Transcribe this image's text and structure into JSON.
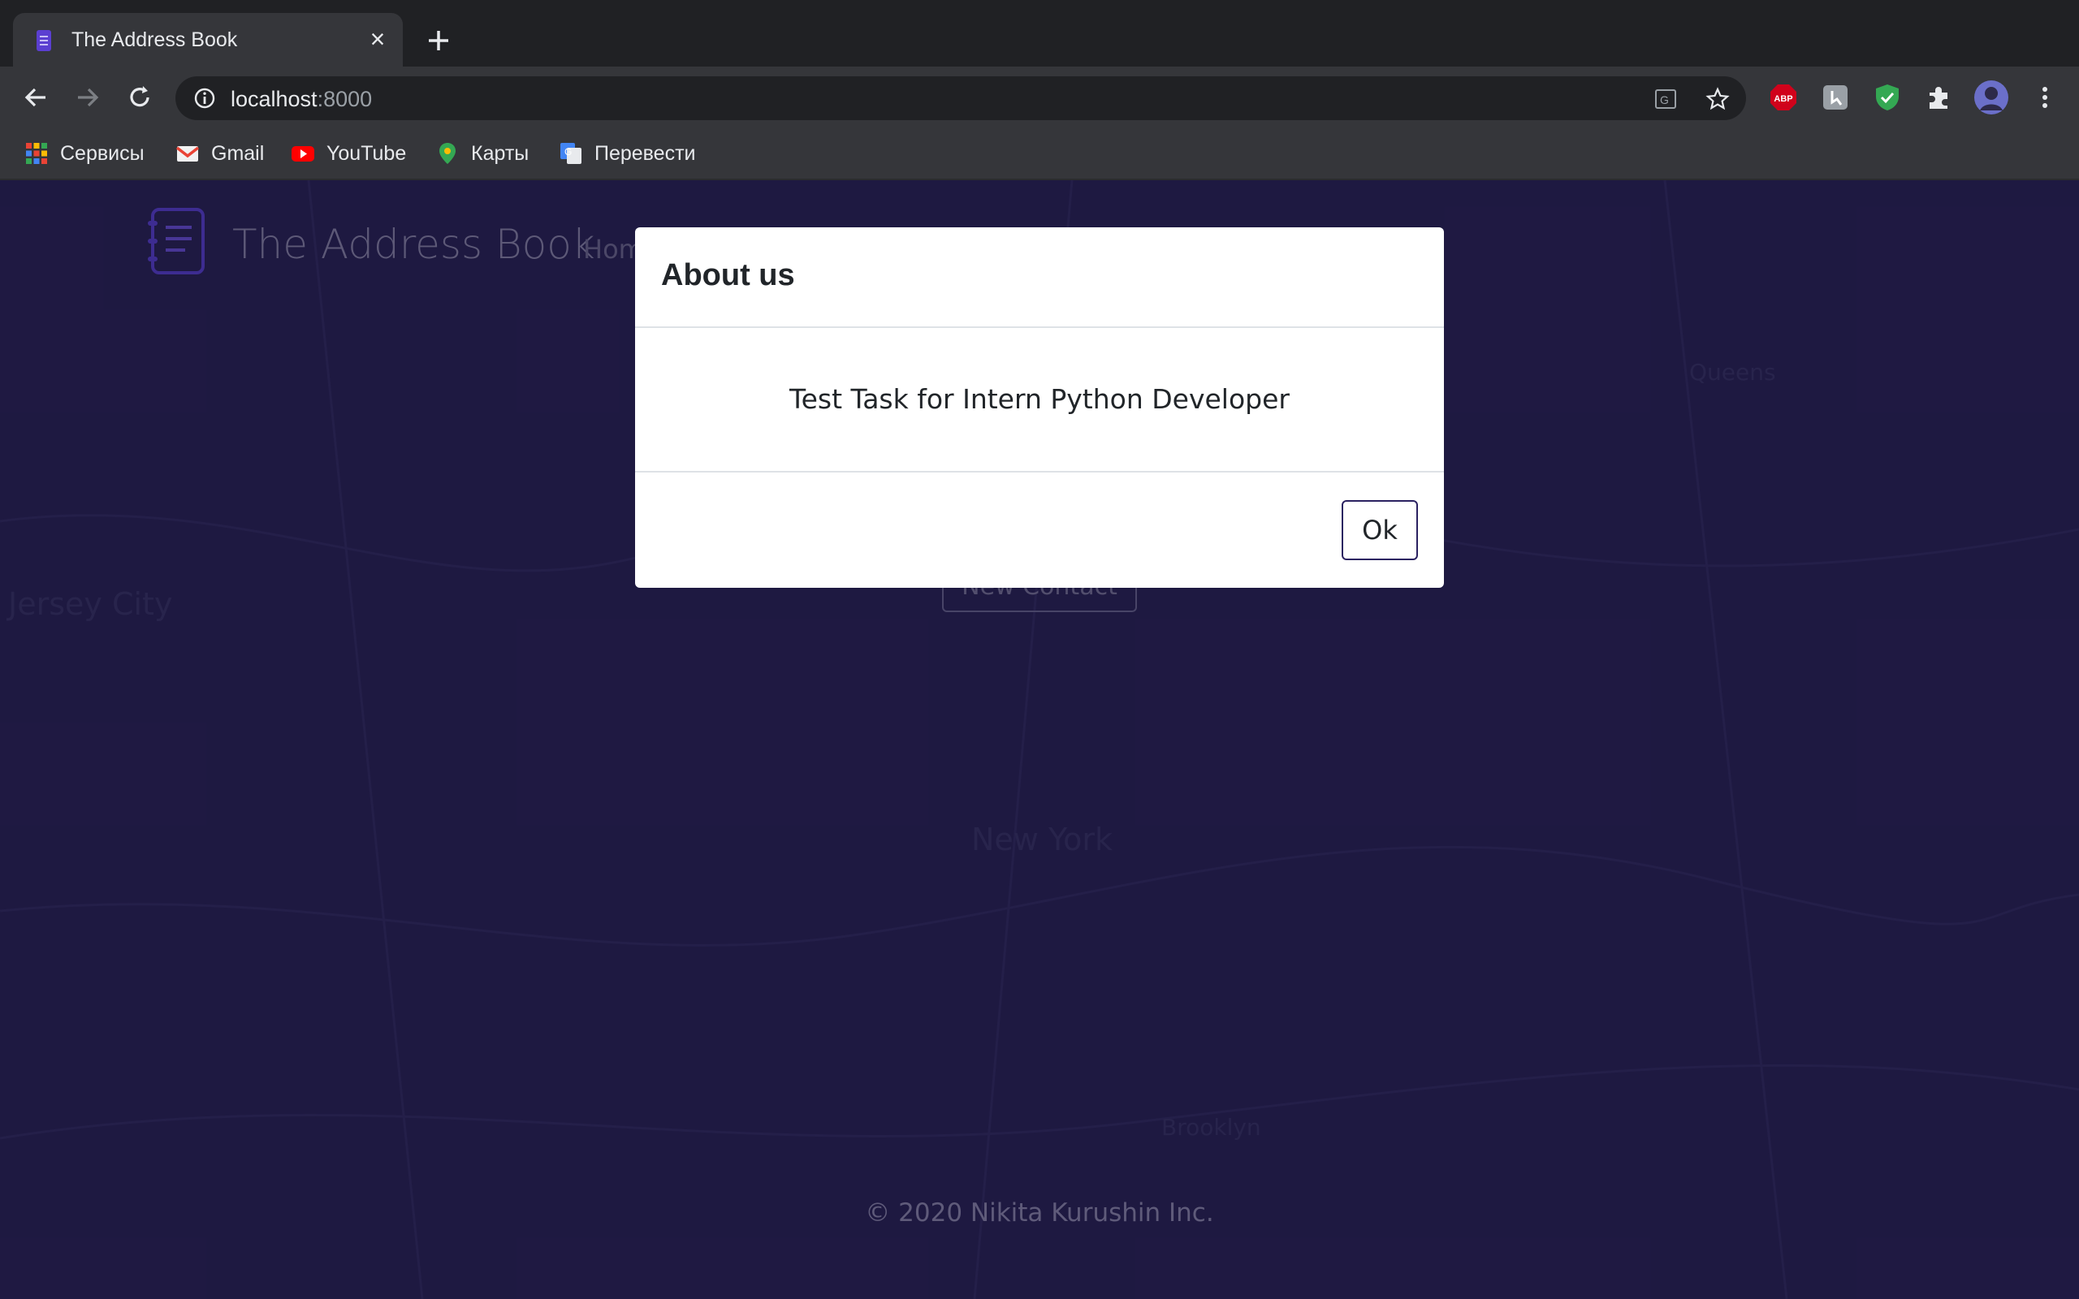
{
  "browser": {
    "tab_title": "The Address Book",
    "url_host": "localhost",
    "url_port": ":8000",
    "bookmarks": [
      "Сервисы",
      "Gmail",
      "YouTube",
      "Карты",
      "Перевести"
    ]
  },
  "page": {
    "brand": "The Address Book",
    "nav_home": "Hom",
    "new_contact_label": "New Contact",
    "footer": "© 2020 Nikita Kurushin Inc.",
    "map_labels": [
      "Jersey City",
      "New York",
      "Brooklyn",
      "Queens"
    ]
  },
  "modal": {
    "title": "About us",
    "body": "Test Task for Intern Python Developer",
    "ok_label": "Ok"
  },
  "colors": {
    "page_bg": "#2a2255",
    "chrome_bg": "#35363a",
    "accent": "#2b2261"
  }
}
